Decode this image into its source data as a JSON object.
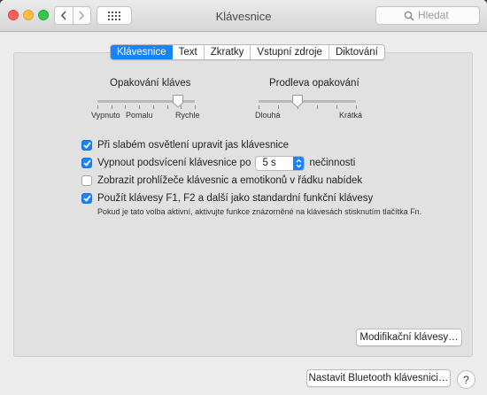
{
  "window": {
    "title": "Klávesnice"
  },
  "toolbar": {
    "search_placeholder": "Hledat",
    "back_icon": "chevron-left-icon",
    "forward_icon": "chevron-right-icon",
    "grid_icon": "show-all-grid-icon"
  },
  "tabs": [
    {
      "label": "Klávesnice",
      "active": true
    },
    {
      "label": "Text",
      "active": false
    },
    {
      "label": "Zkratky",
      "active": false
    },
    {
      "label": "Vstupní zdroje",
      "active": false
    },
    {
      "label": "Diktování",
      "active": false
    }
  ],
  "sliders": {
    "repeat": {
      "title": "Opakování kláves",
      "labels": [
        "Vypnuto",
        "Pomalu",
        "Rychle"
      ],
      "value_fraction": 0.83
    },
    "delay": {
      "title": "Prodleva opakování",
      "labels": [
        "Dlouhá",
        "Krátká"
      ],
      "value_fraction": 0.4
    }
  },
  "options": {
    "adjust_brightness": {
      "label": "Při slabém osvětlení upravit jas klávesnice",
      "checked": true
    },
    "backlight_off": {
      "label_before": "Vypnout podsvícení klávesnice po",
      "select_value": "5 s",
      "label_after": "nečinnosti",
      "checked": true
    },
    "show_viewers": {
      "label": "Zobrazit prohlížeče klávesnic a emotikonů v řádku nabídek",
      "checked": false
    },
    "fn_keys": {
      "label": "Použít klávesy F1, F2 a další jako standardní funkční klávesy",
      "checked": true
    },
    "fn_note": "Pokud je tato volba aktivní, aktivujte funkce znázorněné na klávesách stisknutím tlačítka Fn."
  },
  "buttons": {
    "modifier_keys": "Modifikační klávesy…",
    "bluetooth_keyboard": "Nastavit Bluetooth klávesnici…",
    "help": "?"
  },
  "colors": {
    "accent": "#1a82fb"
  }
}
